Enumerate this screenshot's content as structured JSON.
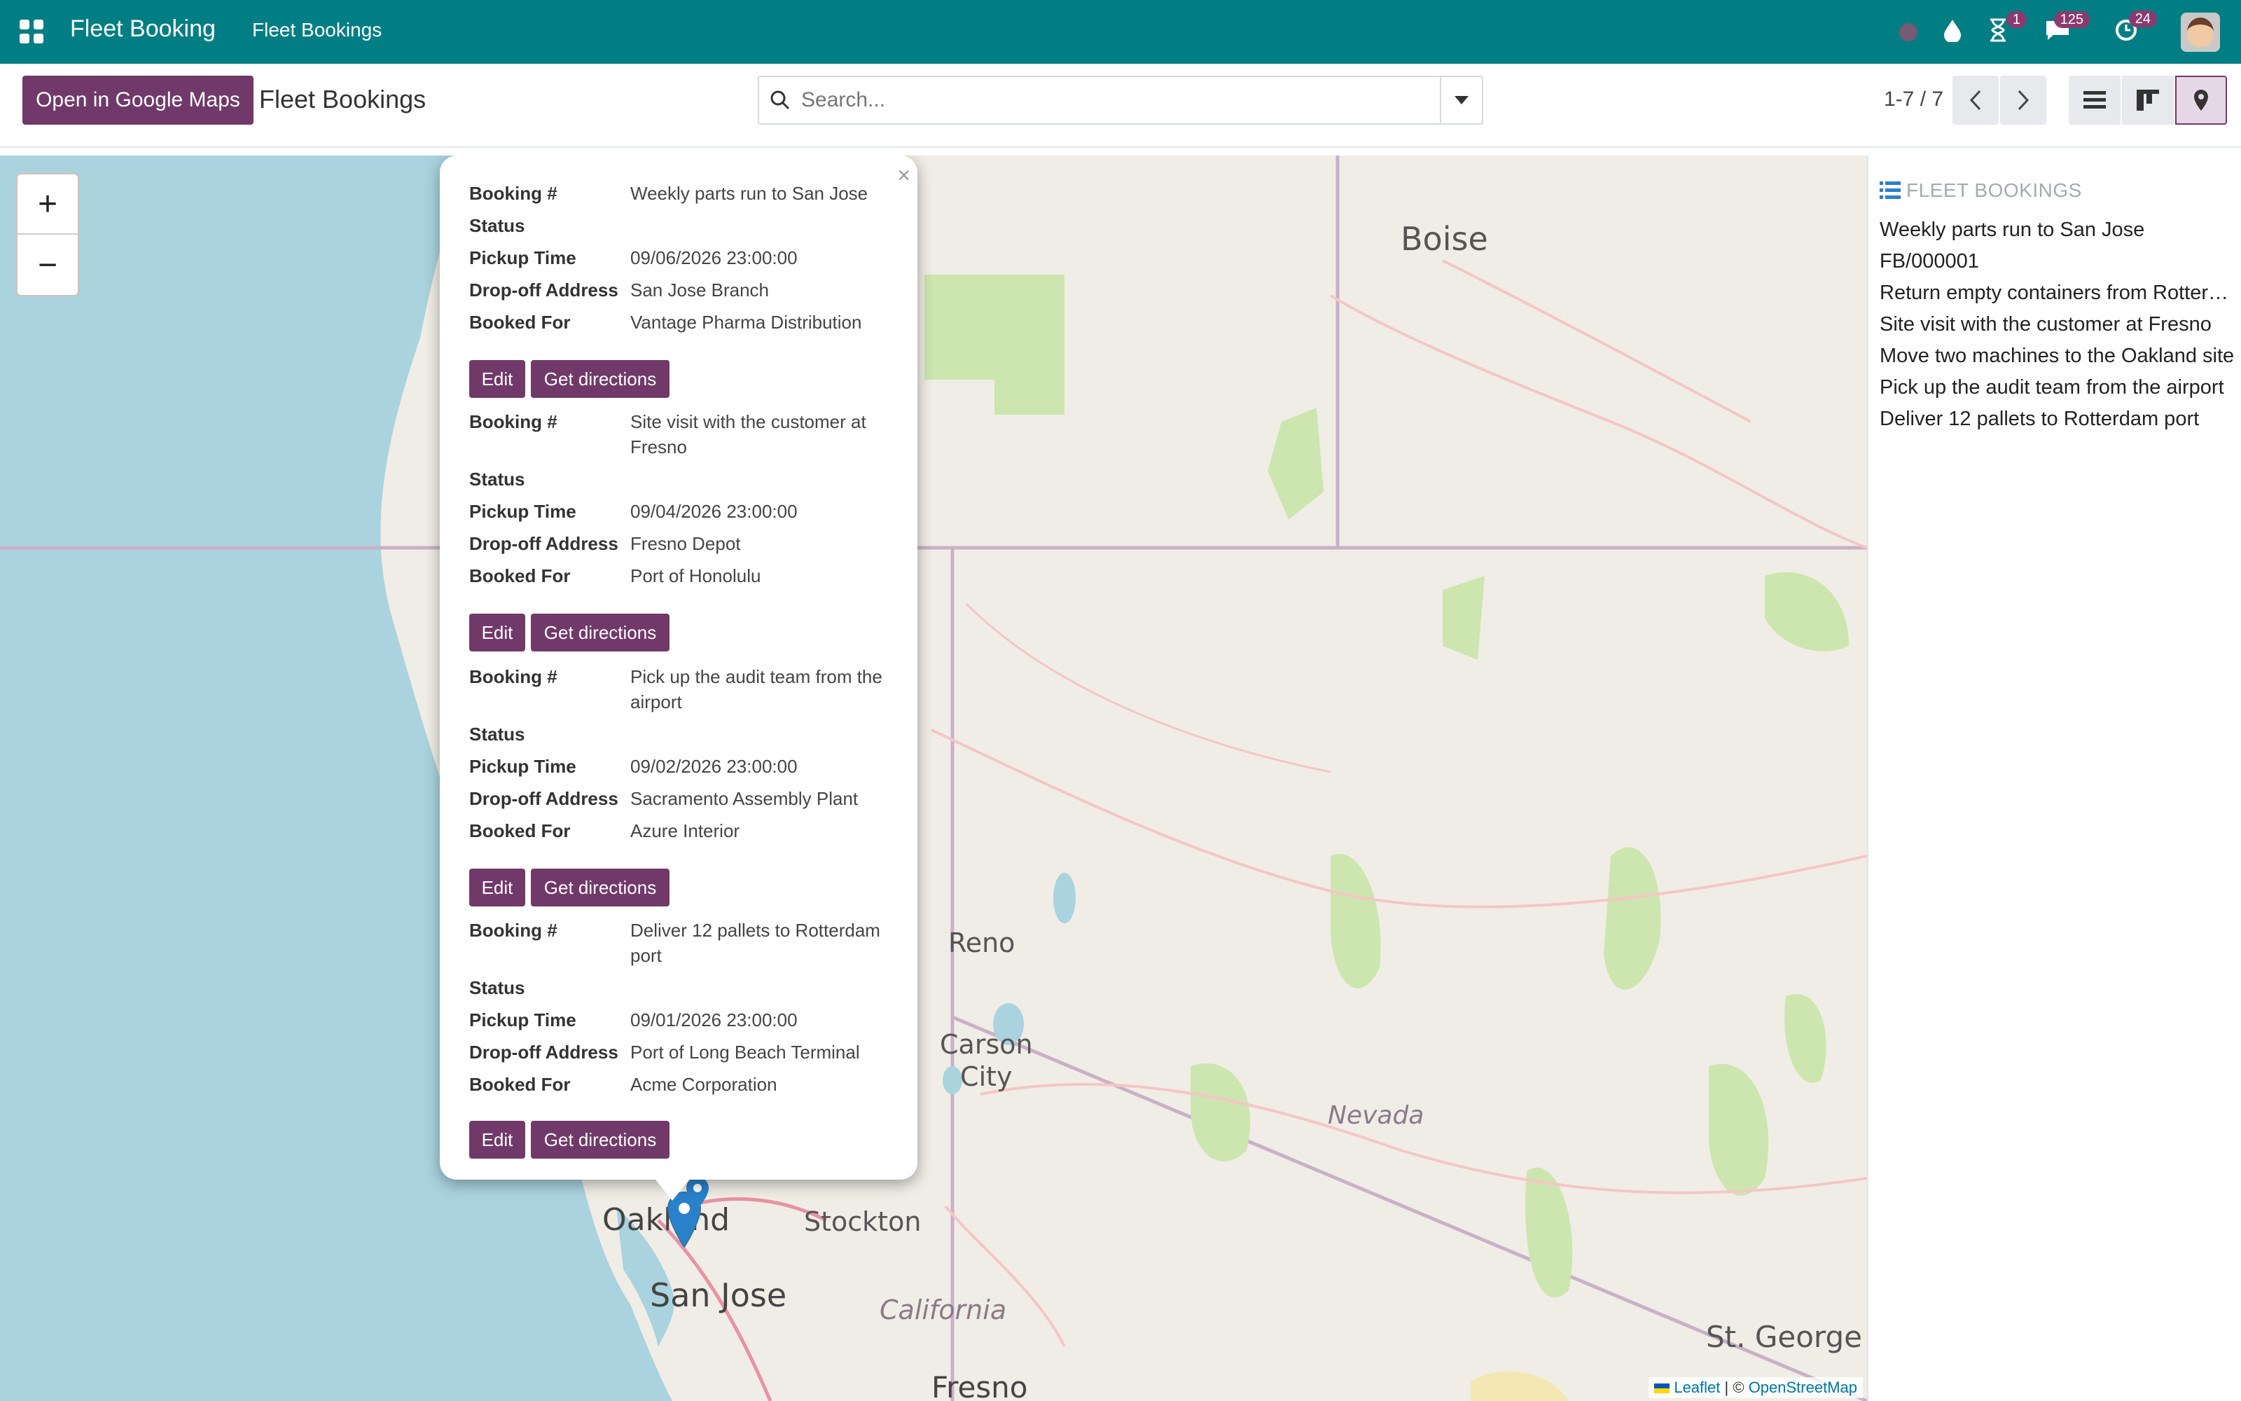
{
  "navbar": {
    "app_name": "Fleet Booking",
    "menu_item": "Fleet Bookings",
    "activity_badge": "1",
    "messages_badge": "125",
    "updates_badge": "24",
    "color": "#017e84"
  },
  "control_panel": {
    "google_maps_button": "Open in Google Maps",
    "title": "Fleet Bookings",
    "search_placeholder": "Search...",
    "pager": "1-7 / 7"
  },
  "map": {
    "zoom_in": "+",
    "zoom_out": "−",
    "labels": {
      "boise": "Boise",
      "reno": "Reno",
      "carson_city": "Carson\nCity",
      "nevada": "Nevada",
      "oakland": "Oakland",
      "stockton": "Stockton",
      "san_jose": "San Jose",
      "california": "California",
      "fresno": "Fresno",
      "st_george": "St. George"
    },
    "attribution_leaflet": "Leaflet",
    "attribution_sep": "| ©",
    "attribution_osm": "OpenStreetMap"
  },
  "popup": {
    "labels": {
      "booking": "Booking #",
      "status": "Status",
      "pickup": "Pickup Time",
      "dropoff": "Drop-off Address",
      "booked_for": "Booked For"
    },
    "edit_label": "Edit",
    "directions_label": "Get directions",
    "records": [
      {
        "booking": "Weekly parts run to San Jose",
        "status": "",
        "pickup": "09/06/2026 23:00:00",
        "dropoff": "San Jose Branch",
        "booked_for": "Vantage Pharma Distribution"
      },
      {
        "booking": "Site visit with the customer at Fresno",
        "status": "",
        "pickup": "09/04/2026 23:00:00",
        "dropoff": "Fresno Depot",
        "booked_for": "Port of Honolulu"
      },
      {
        "booking": "Pick up the audit team from the airport",
        "status": "",
        "pickup": "09/02/2026 23:00:00",
        "dropoff": "Sacramento Assembly Plant",
        "booked_for": "Azure Interior"
      },
      {
        "booking": "Deliver 12 pallets to Rotterdam port",
        "status": "",
        "pickup": "09/01/2026 23:00:00",
        "dropoff": "Port of Long Beach Terminal",
        "booked_for": "Acme Corporation"
      }
    ]
  },
  "sidebar": {
    "title": "Fleet Bookings",
    "items": [
      "Weekly parts run to San Jose",
      "FB/000001",
      "Return empty containers from Rotterdam",
      "Site visit with the customer at Fresno",
      "Move two machines to the Oakland site",
      "Pick up the audit team from the airport",
      "Deliver 12 pallets to Rotterdam port"
    ]
  },
  "colors": {
    "primary": "#71396a",
    "navbar": "#017e84",
    "marker": "#2a81cb"
  }
}
